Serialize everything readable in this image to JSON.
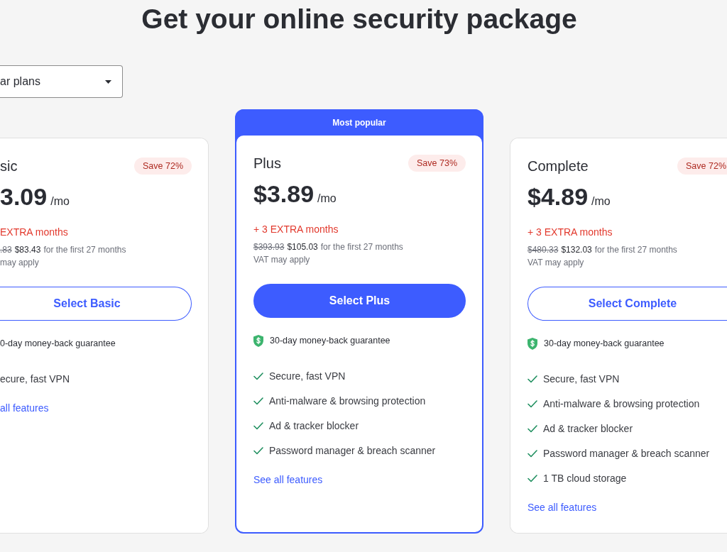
{
  "title": "Get your online security package",
  "plan_selector": {
    "value": "ar plans"
  },
  "cards": [
    {
      "featured": false,
      "name": "sic",
      "save_badge": "Save 72%",
      "price": "3.09",
      "period": "/mo",
      "extra": "EXTRA months",
      "old_price": ".83",
      "new_price": "$83.43",
      "term": "for the first 27 months",
      "vat": "may apply",
      "button": "Select Basic",
      "guarantee": "0-day money-back guarantee",
      "features": [
        "ecure, fast VPN"
      ],
      "link": "all features"
    },
    {
      "featured": true,
      "banner": "Most popular",
      "name": "Plus",
      "save_badge": "Save 73%",
      "price": "$3.89",
      "period": "/mo",
      "extra": "+ 3 EXTRA months",
      "old_price": "$393.93",
      "new_price": "$105.03",
      "term": "for the first 27 months",
      "vat": "VAT may apply",
      "button": "Select Plus",
      "guarantee": "30-day money-back guarantee",
      "features": [
        "Secure, fast VPN",
        "Anti-malware & browsing protection",
        "Ad & tracker blocker",
        "Password manager & breach scanner"
      ],
      "link": "See all features"
    },
    {
      "featured": false,
      "name": "Complete",
      "save_badge": "Save 72%",
      "price": "$4.89",
      "period": "/mo",
      "extra": "+ 3 EXTRA months",
      "old_price": "$480.33",
      "new_price": "$132.03",
      "term": "for the first 27 months",
      "vat": "VAT may apply",
      "button": "Select Complete",
      "guarantee": "30-day money-back guarantee",
      "features": [
        "Secure, fast VPN",
        "Anti-malware & browsing protection",
        "Ad & tracker blocker",
        "Password manager & breach scanner",
        "1 TB cloud storage"
      ],
      "link": "See all features"
    }
  ]
}
